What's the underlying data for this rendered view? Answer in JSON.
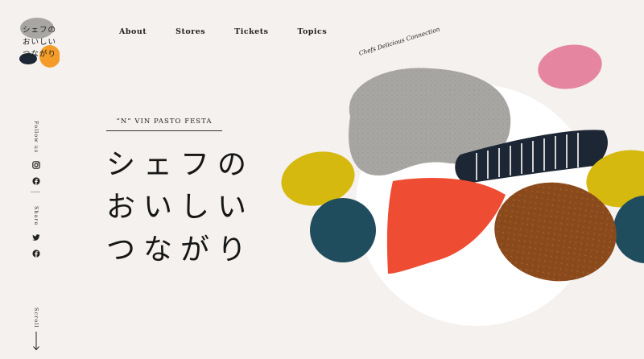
{
  "logo": {
    "lines": [
      "シェフの",
      "おいしい",
      "つながり"
    ],
    "subtitle": "Chefs Delicious Connection"
  },
  "nav": {
    "items": [
      "About",
      "Stores",
      "Tickets",
      "Topics"
    ]
  },
  "social": {
    "follow_label": "Follow us",
    "share_label": "Share",
    "scroll_label": "Scroll"
  },
  "hero": {
    "eyebrow": "“N” VIN PASTO FESTA",
    "title_lines": [
      "シェフの",
      "おいしい",
      "つながり"
    ],
    "script": "Chefs Delicious Connection"
  },
  "colors": {
    "background": "#f4f1ee",
    "gray": "#a7a6a3",
    "pink": "#e5859f",
    "yellow": "#d6b90f",
    "teal": "#1f4d5e",
    "red": "#ee4c33",
    "brown": "#8b4a1c",
    "navy": "#1c2634"
  },
  "icons": [
    "instagram-icon",
    "facebook-icon",
    "twitter-icon",
    "facebook-icon",
    "arrow-down-icon"
  ]
}
